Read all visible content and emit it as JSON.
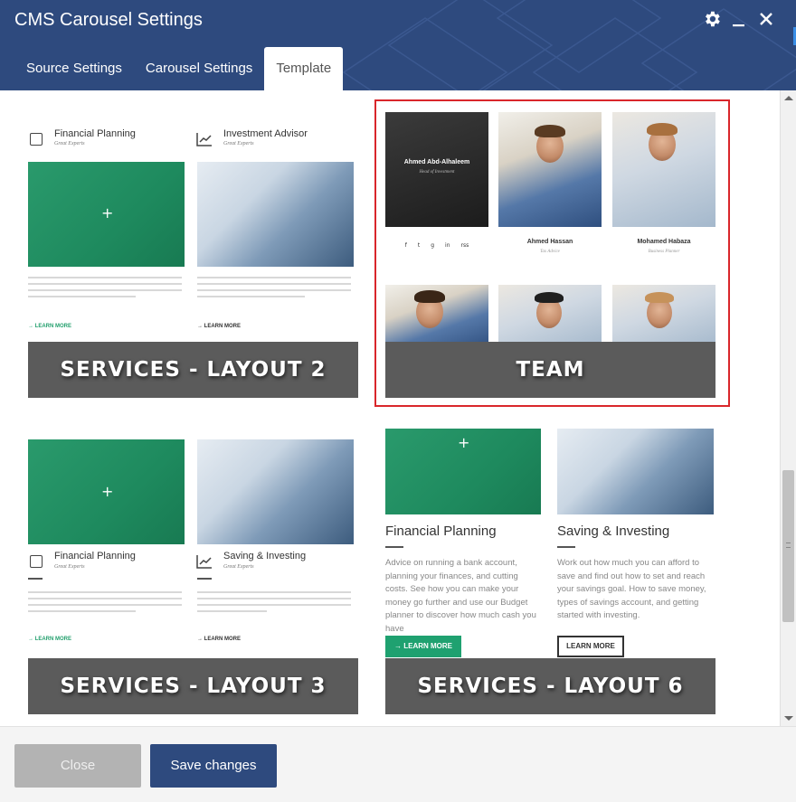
{
  "dialog": {
    "title": "CMS Carousel Settings"
  },
  "header": {
    "icons": [
      "gear-icon",
      "minimize-icon",
      "close-icon"
    ]
  },
  "tabs": [
    {
      "label": "Source Settings",
      "active": false
    },
    {
      "label": "Carousel Settings",
      "active": false
    },
    {
      "label": "Template",
      "active": true
    }
  ],
  "templates": [
    {
      "label": "SERVICES - LAYOUT 2",
      "selected": false,
      "preview": {
        "col1_title": "Financial Planning",
        "col1_sub": "Great Experts",
        "col2_title": "Investment Advisor",
        "col2_sub": "Great Experts",
        "col1_link": "→ LEARN MORE",
        "col2_link": "→ LEARN MORE"
      }
    },
    {
      "label": "TEAM",
      "selected": true,
      "preview": {
        "member1_name": "Ahmed Abd-Alhaleem",
        "member1_role": "Head of Investment",
        "member2_name": "Ahmed Hassan",
        "member2_role": "Tax Advice",
        "member3_name": "Mohamed Habaza",
        "member3_role": "Business Planner",
        "social": [
          "f",
          "t",
          "g",
          "in",
          "rss"
        ]
      }
    },
    {
      "label": "SERVICES - LAYOUT 3",
      "selected": false,
      "preview": {
        "col1_title": "Financial Planning",
        "col1_sub": "Great Experts",
        "col2_title": "Saving & Investing",
        "col2_sub": "Great Experts",
        "col1_link": "→ LEARN MORE",
        "col2_link": "→ LEARN MORE"
      }
    },
    {
      "label": "SERVICES - LAYOUT 6",
      "selected": false,
      "preview": {
        "col1_title": "Financial Planning",
        "col1_text": "Advice on running a bank account, planning your finances, and cutting costs. See how you can make your money go further and use our Budget planner to discover how much cash you have",
        "col2_title": "Saving & Investing",
        "col2_text": "Work out how much you can afford to save and find out how to set and reach your savings goal. How to save money, types of savings account, and getting started with investing.",
        "col1_button": "→ LEARN MORE",
        "col2_button": "LEARN MORE"
      }
    }
  ],
  "footer": {
    "close_label": "Close",
    "save_label": "Save changes"
  },
  "colors": {
    "header": "#2e4a7e",
    "accent_green": "#1fa170",
    "selected_border": "#d9262b",
    "label_bg": "#5b5b5b"
  }
}
